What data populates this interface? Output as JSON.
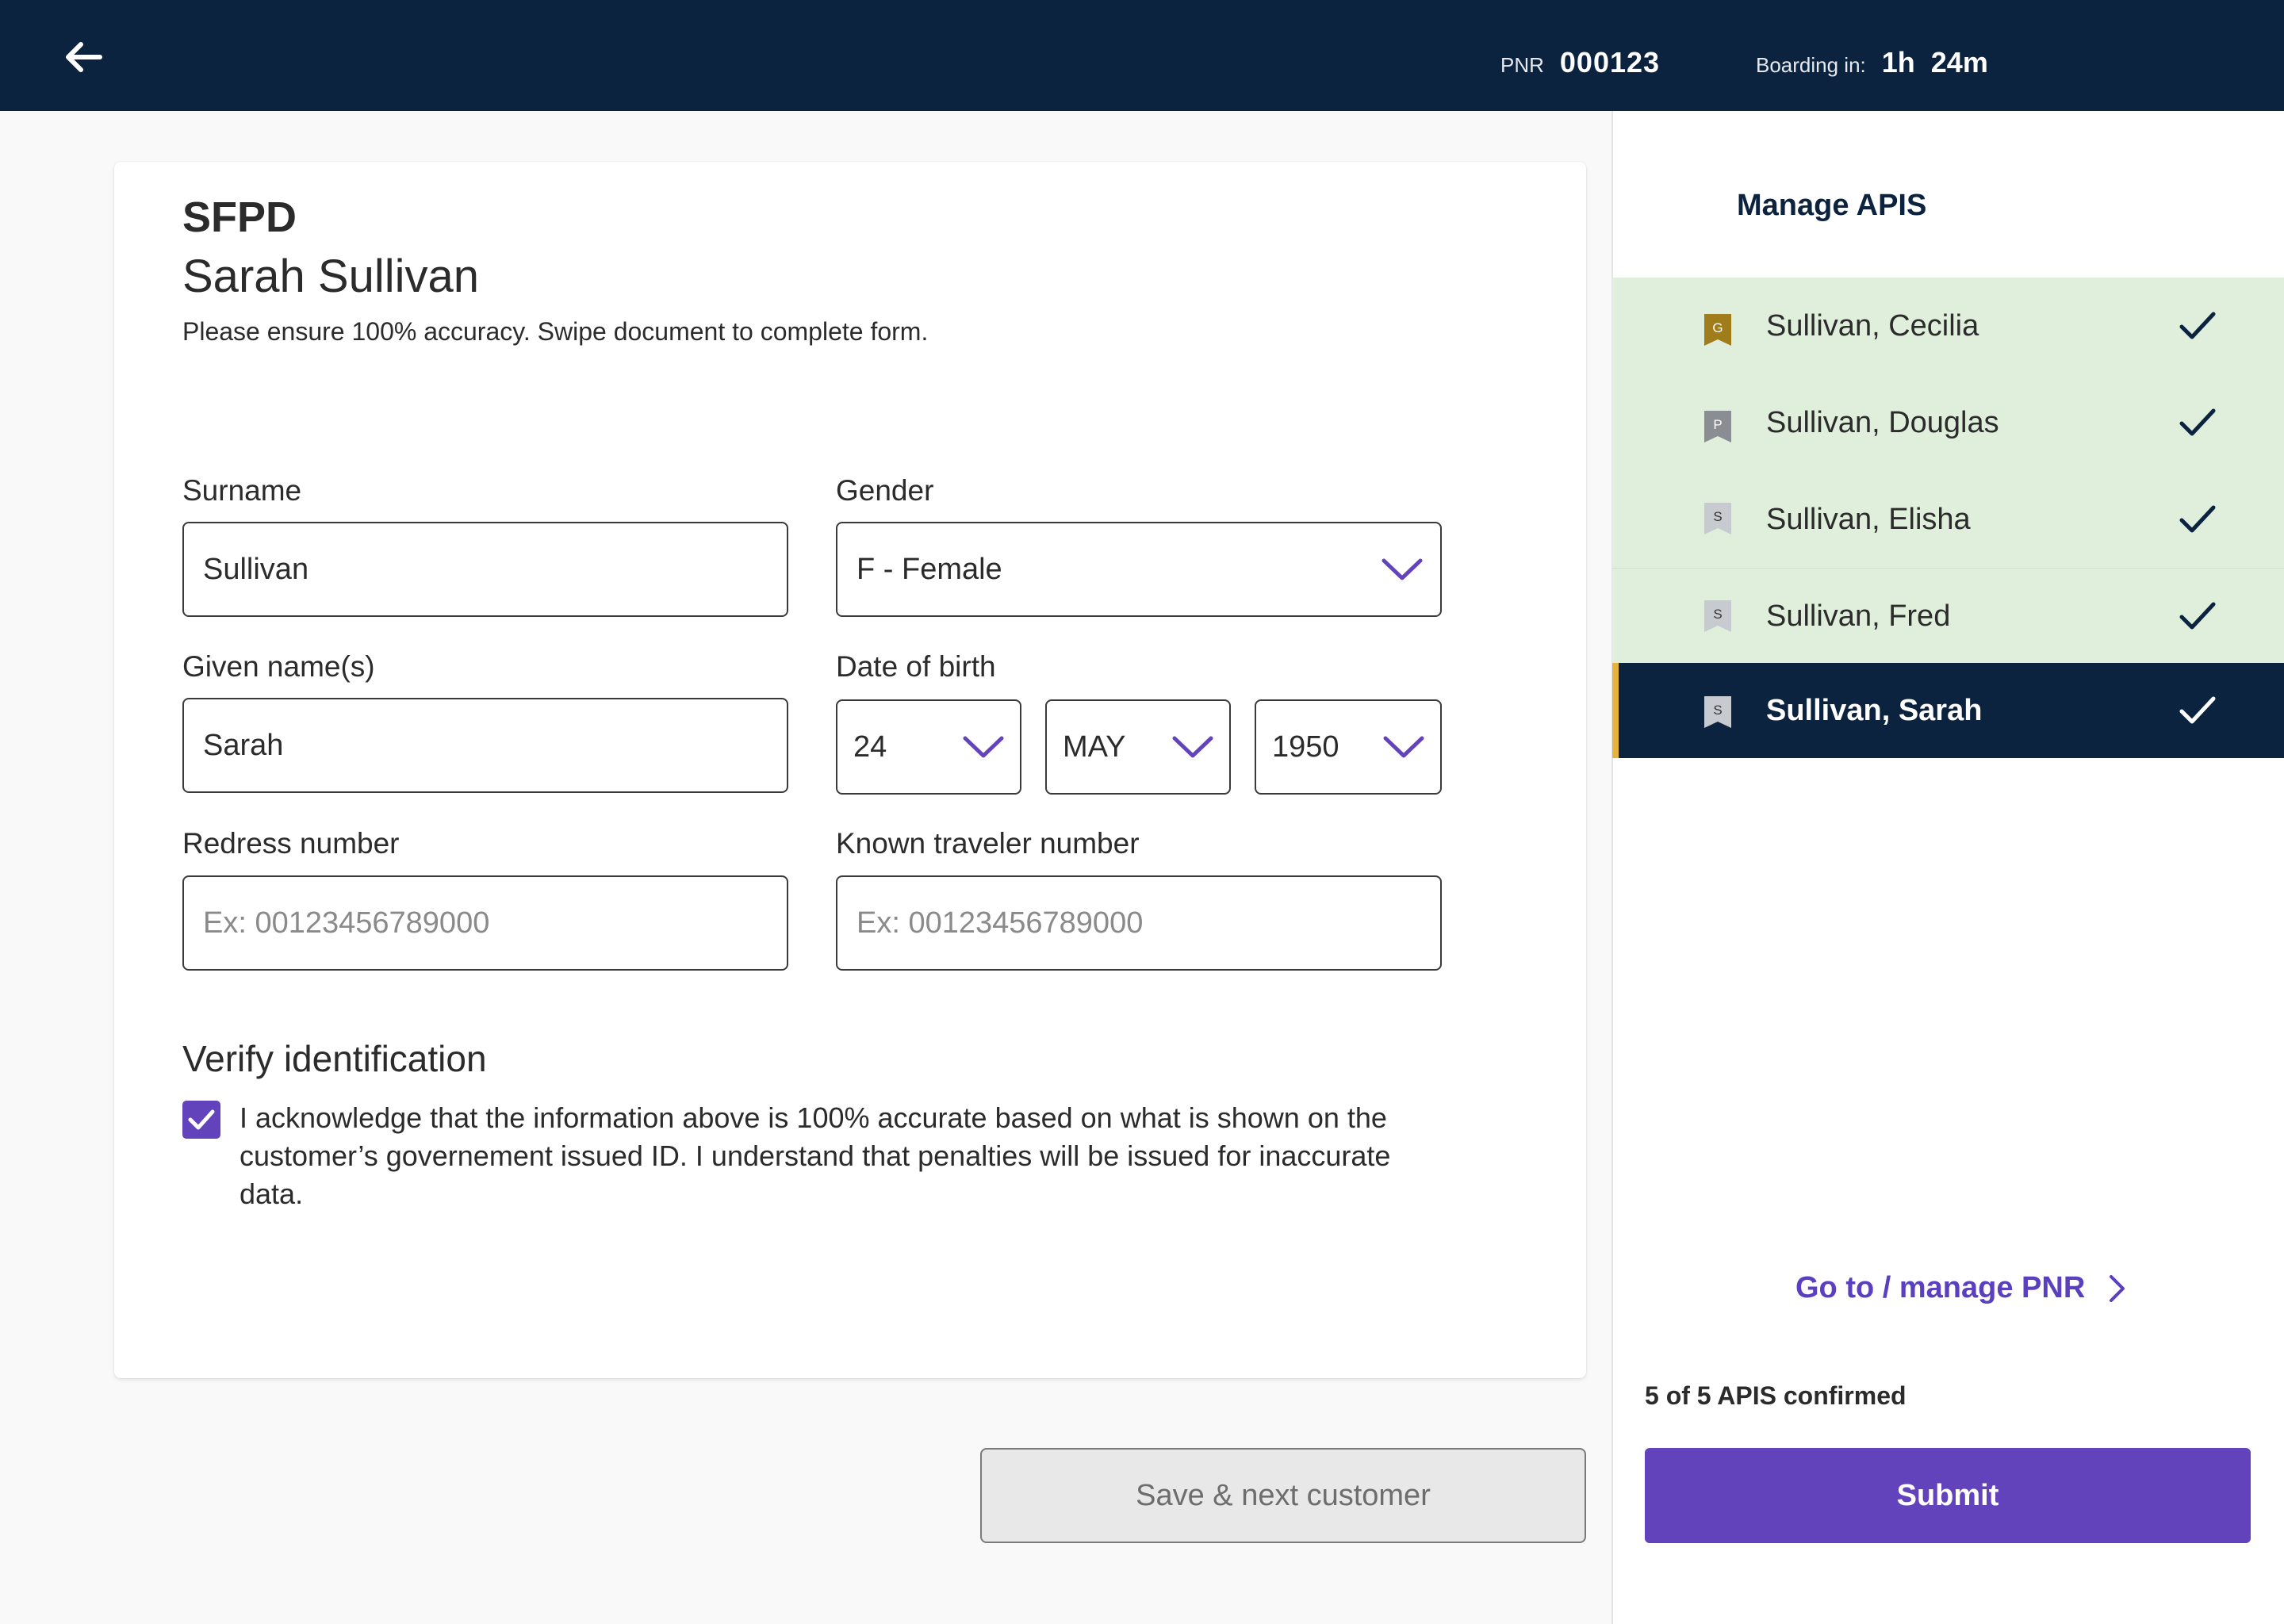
{
  "header": {
    "pnr_label": "PNR",
    "pnr_value": "000123",
    "boarding_label": "Boarding in:",
    "boarding_value": "1h 24m"
  },
  "form": {
    "doc_code": "SFPD",
    "passenger_name": "Sarah Sullivan",
    "instructions": "Please ensure 100% accuracy. Swipe document to complete form.",
    "surname": {
      "label": "Surname",
      "value": "Sullivan"
    },
    "gender": {
      "label": "Gender",
      "value": "F - Female"
    },
    "given_names": {
      "label": "Given name(s)",
      "value": "Sarah"
    },
    "date_of_birth": {
      "label": "Date of birth",
      "day": "24",
      "month": "MAY",
      "year": "1950"
    },
    "redress": {
      "label": "Redress number",
      "placeholder": "Ex: 00123456789000"
    },
    "known_traveler": {
      "label": "Known traveler number",
      "placeholder": "Ex: 00123456789000"
    },
    "verify_title": "Verify identification",
    "acknowledgement": "I acknowledge that the information above is 100% accurate based on what is shown on the customer’s governement issued ID. I understand that penalties will be issued for inaccurate data.",
    "acknowledged": true,
    "save_label": "Save & next customer"
  },
  "panel": {
    "title": "Manage APIS",
    "passengers": [
      {
        "badge": "G",
        "badge_color": "#a07c1a",
        "name": "Sullivan, Cecilia",
        "confirmed": true
      },
      {
        "badge": "P",
        "badge_color": "#8a8d92",
        "name": "Sullivan, Douglas",
        "confirmed": true
      },
      {
        "badge": "S",
        "badge_color": "#c7cacf",
        "name": "Sullivan, Elisha",
        "confirmed": true
      },
      {
        "badge": "S",
        "badge_color": "#c7cacf",
        "name": "Sullivan, Fred",
        "confirmed": true
      },
      {
        "badge": "S",
        "badge_color": "#c7cacf",
        "name": "Sullivan, Sarah",
        "confirmed": true,
        "active": true
      }
    ],
    "goto_label": "Go to / manage PNR",
    "status": "5 of 5 APIS confirmed",
    "submit_label": "Submit"
  },
  "colors": {
    "header_bg": "#0c2340",
    "accent_purple": "#6243bb",
    "confirmed_row_bg": "#e0efdc",
    "active_accent": "#e8b33a"
  }
}
